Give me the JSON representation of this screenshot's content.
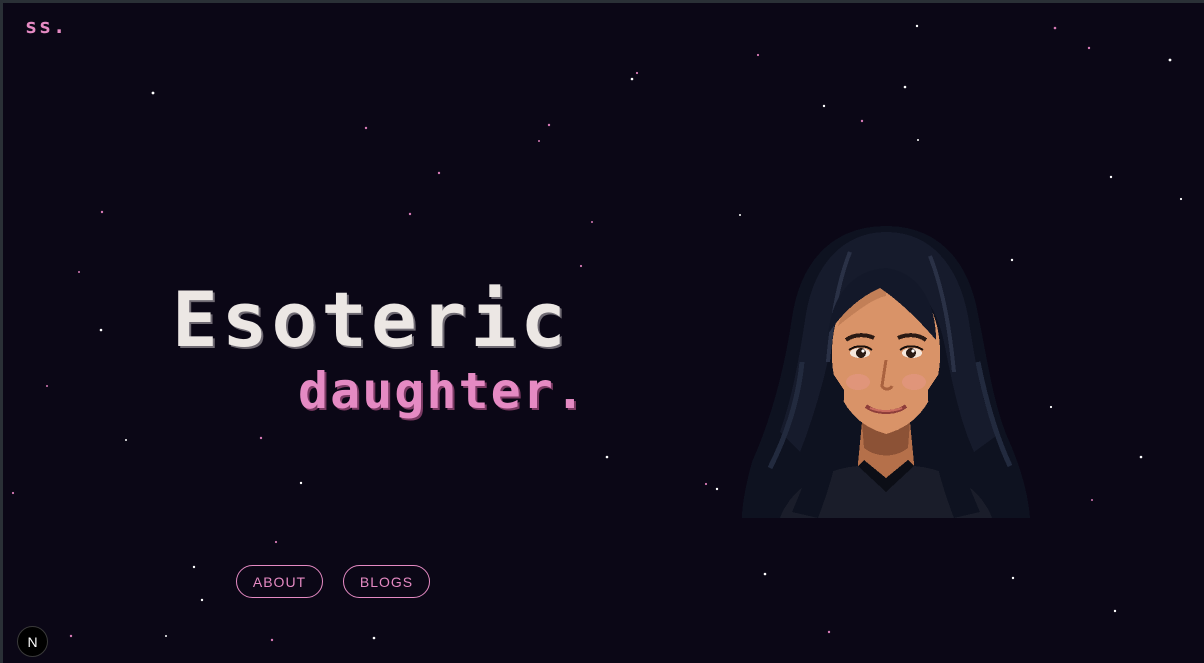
{
  "brand": {
    "logo_text": "ss."
  },
  "hero": {
    "title": "Esoteric",
    "subtitle": "daughter."
  },
  "nav": {
    "about_label": "ABOUT",
    "blogs_label": "BLOGS"
  },
  "dev_badge": {
    "label": "N"
  },
  "colors": {
    "background": "#0b0716",
    "accent_pink": "#e58ac3",
    "title_text": "#ece7e4"
  },
  "portrait": {
    "icon": "pixel-portrait-icon"
  }
}
